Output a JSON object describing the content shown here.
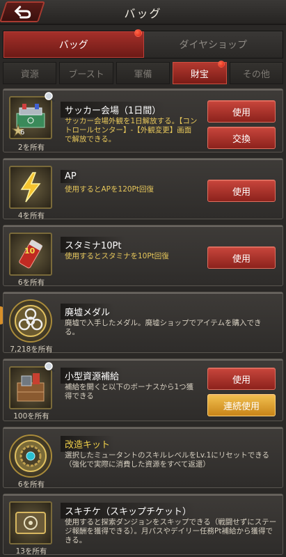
{
  "header": {
    "title": "バッグ"
  },
  "main_tabs": [
    {
      "label": "バッグ",
      "active": true,
      "badge": true
    },
    {
      "label": "ダイヤショップ",
      "active": false,
      "badge": false
    }
  ],
  "sub_tabs": [
    {
      "label": "資源",
      "active": false
    },
    {
      "label": "ブースト",
      "active": false
    },
    {
      "label": "軍備",
      "active": false
    },
    {
      "label": "財宝",
      "active": true,
      "badge": true
    },
    {
      "label": "その他",
      "active": false
    }
  ],
  "items": [
    {
      "name": "サッカー会場（1日間）",
      "desc": "サッカー会場外観を1日解放する。【コントロールセンター】-【外観変更】画面で解放できる。",
      "count": "2を所有",
      "icon": "stadium-icon",
      "icon_number": "6",
      "buttons": [
        "使用",
        "交換"
      ]
    },
    {
      "name": "AP",
      "desc": "使用するとAPを120Pt回復",
      "count": "4を所有",
      "icon": "lightning-icon",
      "buttons": [
        "使用"
      ]
    },
    {
      "name": "スタミナ10Pt",
      "desc": "使用するとスタミナを10Pt回復",
      "count": "6を所有",
      "icon": "stamina-can-icon",
      "icon_number": "10",
      "buttons": [
        "使用"
      ]
    },
    {
      "name": "廃墟メダル",
      "desc": "廃墟で入手したメダル。廃墟ショップでアイテムを購入できる。",
      "count": "7,218を所有",
      "icon": "biohazard-medal-icon",
      "buttons": []
    },
    {
      "name": "小型資源補給",
      "desc": "補給を開くと以下のボーナスから1つ獲得できる",
      "count": "100を所有",
      "icon": "supply-crate-icon",
      "buttons": [
        "使用",
        "連続使用"
      ]
    },
    {
      "name": "改造キット",
      "desc": "選択したミュータントのスキルレベルをLv.1にリセットできる（強化で実際に消費した資源をすべて返還）",
      "count": "6を所有",
      "icon": "gear-medal-icon",
      "buttons": []
    },
    {
      "name": "スキチケ（スキップチケット）",
      "desc": "使用すると探索ダンジョンをスキップできる（戦闘せずにステージ報酬を獲得できる）。月パスやデイリー任務Pt補給から獲得できる。",
      "count": "13を所有",
      "icon": "skip-ticket-icon",
      "buttons": []
    }
  ]
}
